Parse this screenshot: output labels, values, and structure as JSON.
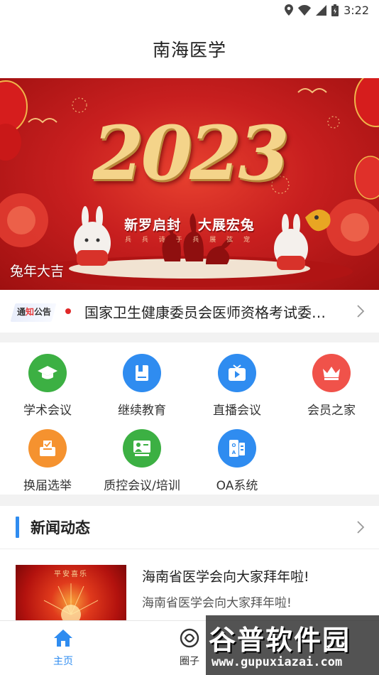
{
  "status_bar": {
    "time": "3:22"
  },
  "header": {
    "title": "南海医学"
  },
  "banner": {
    "year": "2023",
    "slogan_left": "新罗启封",
    "slogan_right": "大展宏兔",
    "small_text": "兵 兵 诗 于 兵 展 弦 宠",
    "caption": "兔年大吉"
  },
  "notice": {
    "tag_prefix": "通",
    "tag_highlight": "知",
    "tag_suffix": "公告",
    "text": "国家卫生健康委员会医师资格考试委员会"
  },
  "menu": {
    "items": [
      {
        "label": "学术会议",
        "icon": "mortarboard-icon",
        "color": "#3cb043"
      },
      {
        "label": "继续教育",
        "icon": "book-icon",
        "color": "#2f8cf0"
      },
      {
        "label": "直播会议",
        "icon": "tv-play-icon",
        "color": "#2f8cf0"
      },
      {
        "label": "会员之家",
        "icon": "crown-icon",
        "color": "#f0524a"
      },
      {
        "label": "换届选举",
        "icon": "ballot-box-icon",
        "color": "#f5922f"
      },
      {
        "label": "质控会议/培训",
        "icon": "presentation-icon",
        "color": "#3cb043"
      },
      {
        "label": "OA系统",
        "icon": "oa-document-icon",
        "color": "#2f8cf0"
      }
    ]
  },
  "news": {
    "section_title": "新闻动态",
    "items": [
      {
        "thumb_text": "平安喜乐",
        "title": "海南省医学会向大家拜年啦!",
        "summary": "海南省医学会向大家拜年啦!"
      }
    ]
  },
  "bottom_nav": {
    "items": [
      {
        "label": "主页",
        "icon": "home-icon",
        "active": true
      },
      {
        "label": "圈子",
        "icon": "circle-icon",
        "active": false
      }
    ],
    "active_color": "#2f8cf0",
    "inactive_color": "#333333"
  },
  "watermark": {
    "text": "谷普软件园",
    "url": "www.gupuxiazai.com"
  }
}
